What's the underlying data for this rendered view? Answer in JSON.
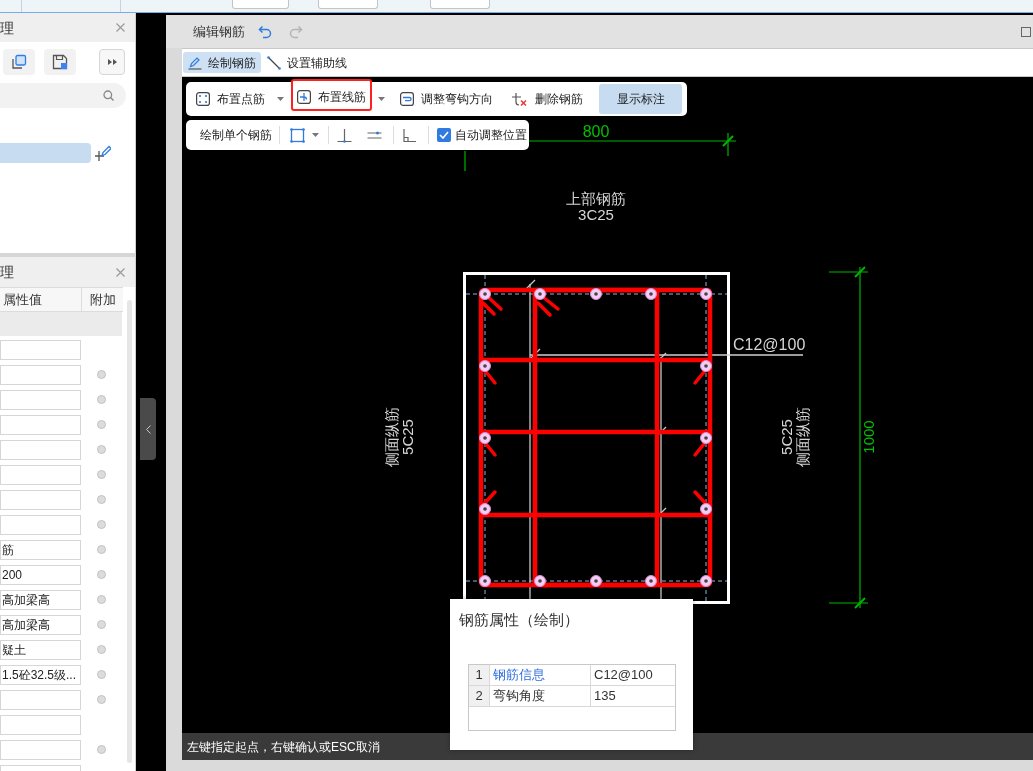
{
  "left_panel": {
    "title": "理",
    "tree": [
      {
        "selected": true
      }
    ]
  },
  "properties_panel": {
    "title": "理",
    "columns": [
      "属性值",
      "附加"
    ],
    "rows": [
      {
        "kind": "field"
      },
      {
        "kind": "option",
        "extra": false
      },
      {
        "kind": "option",
        "extra": false
      },
      {
        "kind": "option",
        "extra": false
      },
      {
        "kind": "option",
        "extra": false
      },
      {
        "kind": "option",
        "extra": false
      },
      {
        "kind": "option",
        "extra": false
      },
      {
        "kind": "option",
        "extra": false
      },
      {
        "kind": "option",
        "extra": false,
        "value": "筋"
      },
      {
        "kind": "option",
        "extra": false,
        "value": "200"
      },
      {
        "kind": "option",
        "extra": false,
        "value": "高加梁高"
      },
      {
        "kind": "option",
        "extra": false,
        "value": "高加梁高"
      },
      {
        "kind": "option",
        "extra": false,
        "value": "疑土"
      },
      {
        "kind": "option",
        "extra": false,
        "value": "1.5砼32.5级..."
      },
      {
        "kind": "option",
        "extra": false
      },
      {
        "kind": "field"
      },
      {
        "kind": "option",
        "extra": false
      },
      {
        "kind": "field"
      }
    ]
  },
  "window": {
    "title": "编辑钢筋"
  },
  "history": {
    "undo_enabled": true,
    "redo_enabled": false
  },
  "mode_tabs": [
    {
      "label": "绘制钢筋",
      "selected": true
    },
    {
      "label": "设置辅助线",
      "selected": false
    }
  ],
  "toolbar": [
    {
      "label": "布置点筋",
      "kind": "split",
      "on": false,
      "highlighted": false
    },
    {
      "label": "布置线筋",
      "kind": "split",
      "on": false,
      "highlighted": true
    },
    {
      "label": "调整弯钩方向",
      "kind": "button",
      "on": false,
      "highlighted": false
    },
    {
      "label": "删除钢筋",
      "kind": "button",
      "on": false,
      "highlighted": false
    },
    {
      "label": "显示标注",
      "kind": "toggle",
      "on": true,
      "highlighted": false
    }
  ],
  "draw_toolbar": {
    "label": "绘制单个钢筋",
    "checkbox": {
      "label": "自动调整位置",
      "checked": true
    }
  },
  "drawing": {
    "top_dimension": "800",
    "right_dimension": "1000",
    "top_label": [
      "上部钢筋",
      "3C25"
    ],
    "left_label": [
      "侧面纵筋",
      "5C25"
    ],
    "right_label": [
      "5C25",
      "侧面纵筋"
    ],
    "stirrup_label": "C12@100"
  },
  "popup": {
    "title": "钢筋属性（绘制）",
    "rows": [
      {
        "index": "1",
        "name": "钢筋信息",
        "value": "C12@100",
        "kind": "link"
      },
      {
        "index": "2",
        "name": "弯钩角度",
        "value": "135",
        "kind": "text"
      }
    ]
  },
  "status_bar": "左键指定起点，右键确认或ESC取消"
}
